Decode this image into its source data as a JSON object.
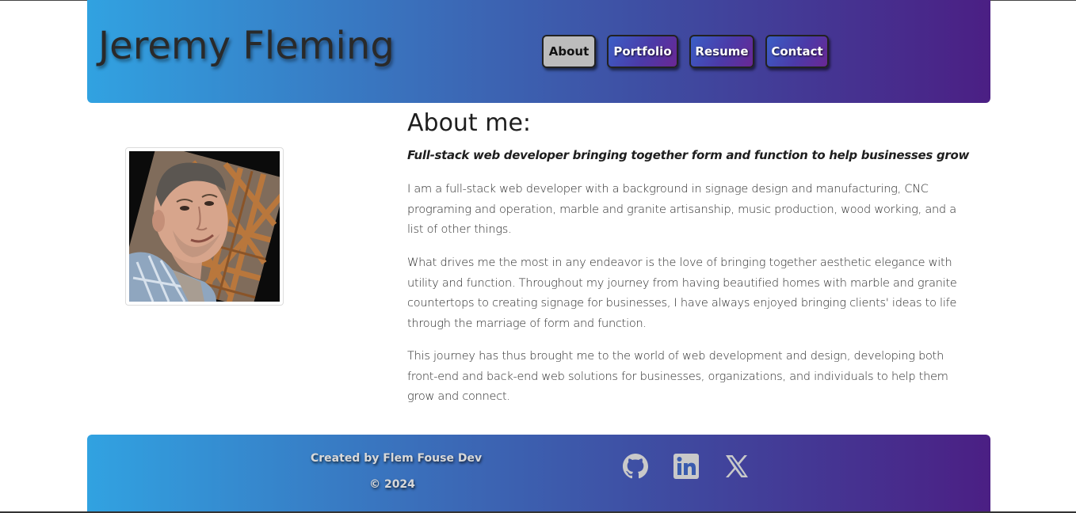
{
  "header": {
    "site_title": "Jeremy Fleming",
    "nav": [
      {
        "label": "About",
        "active": true
      },
      {
        "label": "Portfolio",
        "active": false
      },
      {
        "label": "Resume",
        "active": false
      },
      {
        "label": "Contact",
        "active": false
      }
    ]
  },
  "about": {
    "title": "About me:",
    "tagline": "Full-stack web developer bringing together form and function to help businesses grow",
    "paragraphs": [
      "I am a full-stack web developer with a background in signage design and manufacturing, CNC programing and operation, marble and granite artisanship, music production, wood working, and a list of other things.",
      "What drives me the most in any endeavor is the love of bringing together aesthetic elegance with utility and function. Throughout my journey from having beautified homes with marble and granite countertops to creating signage for businesses, I have always enjoyed bringing clients' ideas to life through the marriage of form and function.",
      "This journey has thus brought me to the world of web development and design, developing both front-end and back-end web solutions for businesses, organizations, and individuals to help them grow and connect."
    ],
    "photo": {
      "alt": "profile-photo"
    }
  },
  "footer": {
    "credit": "Created by Flem Fouse Dev",
    "copyright": "© 2024",
    "social": [
      {
        "icon": "github-icon"
      },
      {
        "icon": "linkedin-icon"
      },
      {
        "icon": "x-icon"
      }
    ]
  },
  "colors": {
    "gradient_start": "#31a2e1",
    "gradient_end": "#4b1f84",
    "active_nav": "#bcbcbc",
    "icon_gray": "#c9c9c9"
  }
}
